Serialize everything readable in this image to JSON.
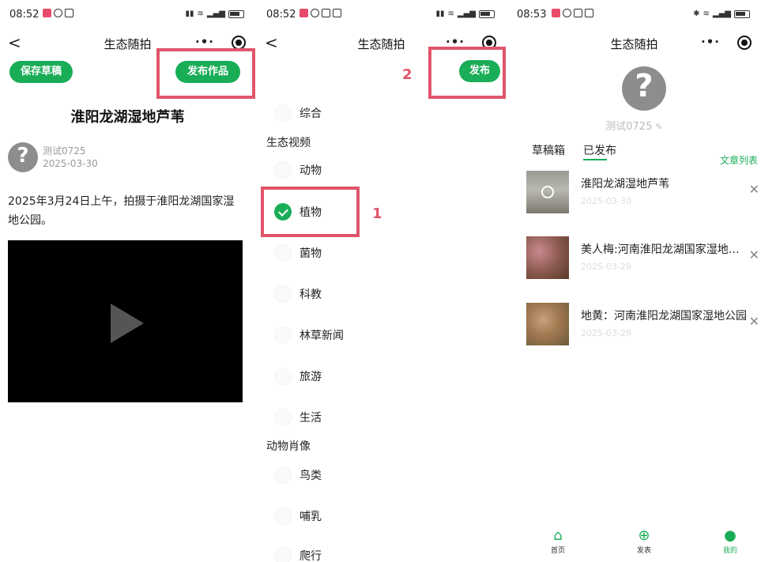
{
  "screens": [
    {
      "status": {
        "time": "08:52"
      },
      "nav": {
        "back": "<",
        "title": "生态随拍",
        "more": "·•·"
      },
      "buttons": {
        "save_draft": "保存草稿",
        "publish_work": "发布作品"
      },
      "article": {
        "title": "淮阳龙湖湿地芦苇",
        "author": "测试0725",
        "date": "2025-03-30",
        "body": "2025年3月24日上午，拍摄于淮阳龙湖国家湿地公园。"
      }
    },
    {
      "status": {
        "time": "08:52"
      },
      "nav": {
        "back": "<",
        "title": "生态随拍",
        "more": "·•·"
      },
      "buttons": {
        "publish": "发布"
      },
      "step_labels": {
        "one": "1",
        "two": "2"
      },
      "categories": {
        "general": "综合",
        "group_eco_video": "生态视频",
        "animals": "动物",
        "plants": "植物",
        "fungi": "菌物",
        "science": "科教",
        "forest_news": "林草新闻",
        "travel": "旅游",
        "life": "生活",
        "group_animal_portrait": "动物肖像",
        "birds": "鸟类",
        "mammals": "哺乳",
        "reptiles": "爬行"
      },
      "selected": "植物"
    },
    {
      "status": {
        "time": "08:53"
      },
      "nav": {
        "title": "生态随拍",
        "more": "·•·"
      },
      "profile": {
        "username": "测试0725"
      },
      "tabs": {
        "drafts": "草稿箱",
        "published": "已发布"
      },
      "article_list_link": "文章列表",
      "items": [
        {
          "title": "淮阳龙湖湿地芦苇",
          "date": "2025-03-30"
        },
        {
          "title": "美人梅:河南淮阳龙湖国家湿地公园",
          "date": "2025-03-29"
        },
        {
          "title": "地黄：河南淮阳龙湖国家湿地公园",
          "date": "2025-03-29"
        }
      ],
      "tabbar": {
        "home": "首页",
        "post": "发表",
        "mine": "我的"
      }
    }
  ],
  "colors": {
    "accent": "#1aad57",
    "highlight": "#e0556a"
  }
}
